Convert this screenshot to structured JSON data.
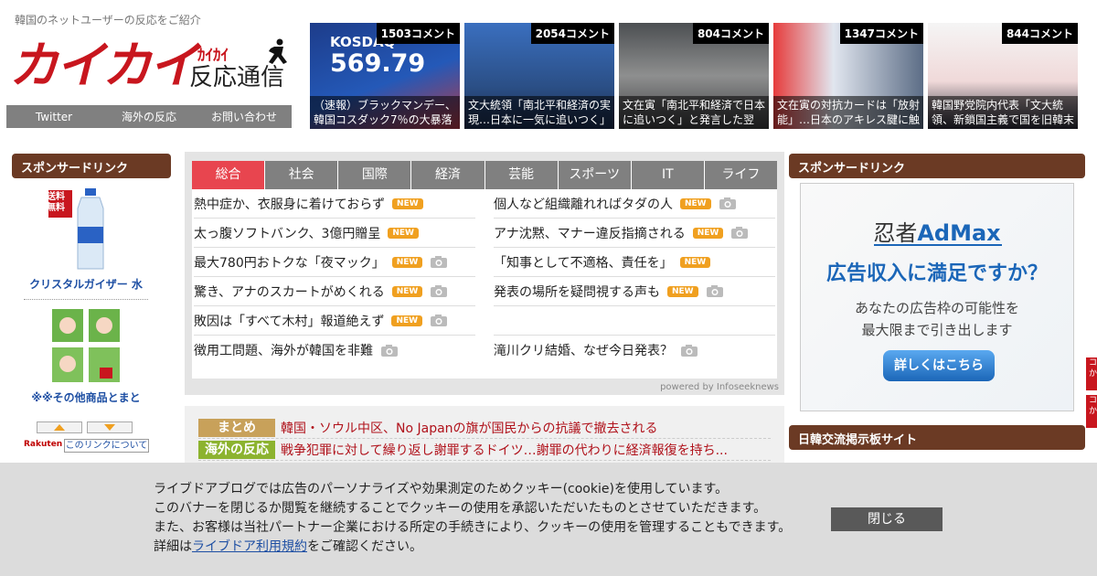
{
  "header": {
    "tagline": "韓国のネットユーザーの反応をご紹介",
    "logo_main": "カイカイ",
    "logo_kana": "ｶｲｶｲ",
    "logo_sub": "反応通信",
    "nav": [
      "Twitter",
      "海外の反応",
      "お問い合わせ"
    ]
  },
  "thumbs": [
    {
      "count": "1503コメント",
      "caption": "（速報）ブラックマンデー、韓国コスダック7％の大暴落",
      "overlay1": "KOSDAQ",
      "overlay2": "569.79"
    },
    {
      "count": "2054コメント",
      "caption": "文大統領「南北平和経済の実現…日本に一気に追いつく」"
    },
    {
      "count": "804コメント",
      "caption": "文在寅「南北平和経済で日本に追いつく」と発言した翌"
    },
    {
      "count": "1347コメント",
      "caption": "文在寅の対抗カードは「放射能」…日本のアキレス腱に触"
    },
    {
      "count": "844コメント",
      "caption": "韓国野党院内代表「文大統領、新鎖国主義で国を旧韓末"
    }
  ],
  "left_sidebar": {
    "heading": "スポンサードリンク",
    "badge": "送料無料",
    "product1": "クリスタルガイザー 水",
    "product2": "※※その他商品とまと",
    "rakuten": "Rakuten",
    "about_link": "このリンクについて"
  },
  "news": {
    "tabs": [
      "総合",
      "社会",
      "国際",
      "経済",
      "芸能",
      "スポーツ",
      "IT",
      "ライフ"
    ],
    "new_label": "NEW",
    "left": [
      {
        "text": "熱中症か、衣服身に着けておらず",
        "new": true,
        "photo": false
      },
      {
        "text": "太っ腹ソフトバンク、3億円贈呈",
        "new": true,
        "photo": false
      },
      {
        "text": "最大780円おトクな「夜マック」",
        "new": true,
        "photo": true
      },
      {
        "text": "驚き、アナのスカートがめくれる",
        "new": true,
        "photo": true
      },
      {
        "text": "敗因は「すべて木村」報道絶えず",
        "new": true,
        "photo": true
      },
      {
        "text": "徴用工問題、海外が韓国を非難",
        "new": false,
        "photo": true
      }
    ],
    "right": [
      {
        "text": "個人など組織離れればタダの人",
        "new": true,
        "photo": true
      },
      {
        "text": "アナ沈黙、マナー違反指摘される",
        "new": true,
        "photo": true
      },
      {
        "text": "「知事として不適格、責任を」",
        "new": true,
        "photo": false
      },
      {
        "text": "発表の場所を疑問視する声も",
        "new": true,
        "photo": true
      },
      {
        "text": "",
        "new": false,
        "photo": false
      },
      {
        "text": "滝川クリ結婚、なぜ今日発表？",
        "new": false,
        "photo": true
      }
    ],
    "powered": "powered by Infoseeknews"
  },
  "matome": [
    {
      "tag": "まとめ",
      "text": "韓国・ソウル中区、No Japanの旗が国民からの抗議で撤去される"
    },
    {
      "tag": "海外の反応",
      "text": "戦争犯罪に対して繰り返し謝罪するドイツ…謝罪の代わりに経済報復を持ち..."
    }
  ],
  "right_sidebar": {
    "heading1": "スポンサードリンク",
    "heading2": "日韓交流掲示板サイト",
    "ad_brand_prefix": "忍者",
    "ad_brand": "AdMax",
    "ad_head": "広告収入に満足ですか？",
    "ad_body1": "あなたの広告枠の可能性を",
    "ad_body2": "最大限まで引き出します",
    "ad_button": "詳しくはこちら",
    "edge1": "コか",
    "edge2": "コか"
  },
  "cookie": {
    "line1": "ライブドアブログでは広告のパーソナライズや効果測定のためクッキー(cookie)を使用しています。",
    "line2": "このバナーを閉じるか閲覧を継続することでクッキーの使用を承認いただいたものとさせていただきます。",
    "line3": "また、お客様は当社パートナー企業における所定の手続きにより、クッキーの使用を管理することもできます。",
    "line4_pre": "詳細は",
    "line4_link": "ライブドア利用規約",
    "line4_post": "をご確認ください。",
    "close": "閉じる"
  },
  "colors": {
    "brand_red": "#c8161e",
    "sidebar_brown": "#6b3a24",
    "tab_active": "#e8454f",
    "new_badge": "#f0a020",
    "link_blue": "#1e4fa3"
  }
}
